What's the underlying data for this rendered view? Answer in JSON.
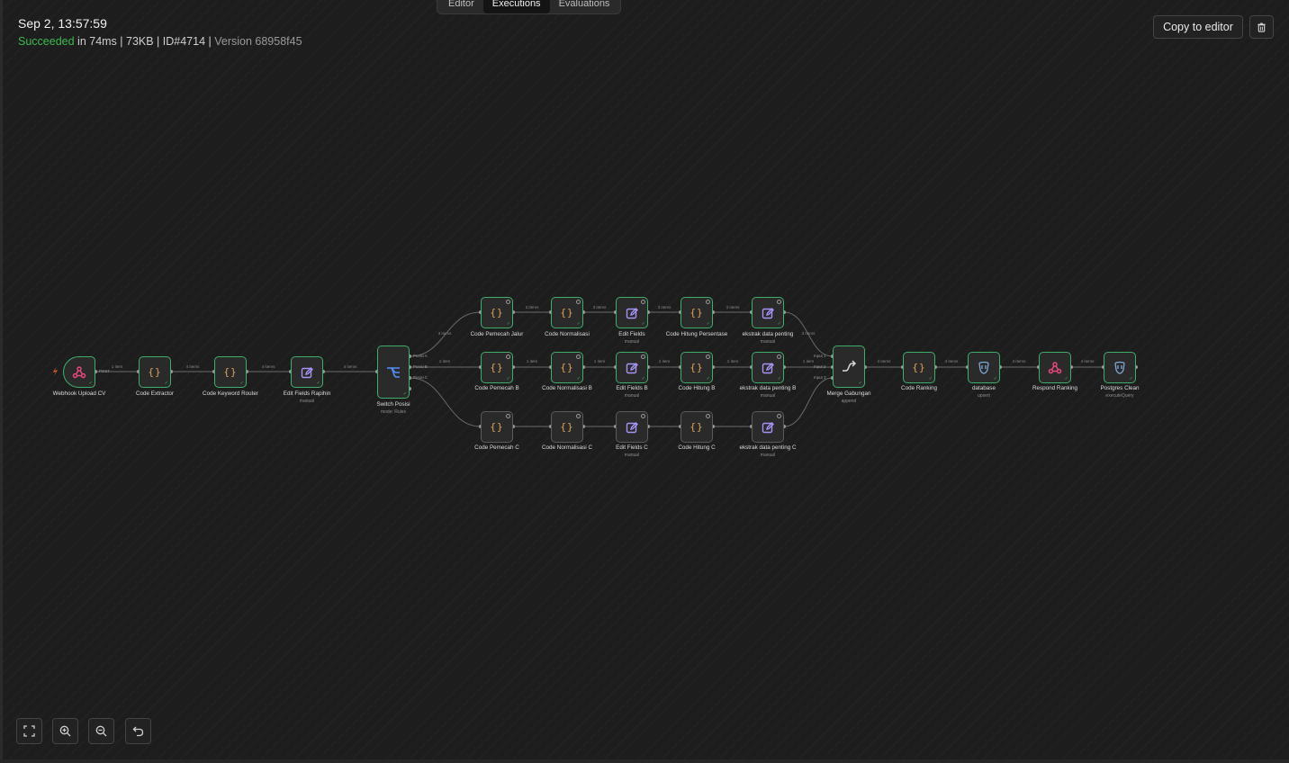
{
  "tabs": [
    {
      "label": "Editor",
      "active": false
    },
    {
      "label": "Executions",
      "active": true
    },
    {
      "label": "Evaluations",
      "active": false
    }
  ],
  "header": {
    "date": "Sep 2, 13:57:59",
    "status": "Succeeded",
    "details": " in 74ms | 73KB | ID#4714 | ",
    "version": "Version 68958f45"
  },
  "actions": {
    "copy_label": "Copy to editor",
    "delete_icon": "trash-icon"
  },
  "colors": {
    "success": "#3fb950",
    "node_border": "#3fae6a",
    "code_icon": "#e2a35a",
    "edit_icon": "#a892f6",
    "switch_icon": "#4f8ff7",
    "merge_icon": "#d9d9d9",
    "webhook_icon": "#e5487a",
    "postgres_icon": "#7fa7d9"
  },
  "nodes": [
    {
      "id": "webhook",
      "label": "Webhook Upload CV",
      "sub": "",
      "icon": "webhook-icon"
    },
    {
      "id": "code_extractor",
      "label": "Code Extractor",
      "sub": "",
      "icon": "code-icon"
    },
    {
      "id": "code_keyword",
      "label": "Code Keyword Router",
      "sub": "",
      "icon": "code-icon"
    },
    {
      "id": "edit_rapihin",
      "label": "Edit Fields Rapihin",
      "sub": "manual",
      "icon": "edit-icon"
    },
    {
      "id": "switch",
      "label": "Switch Posisi",
      "sub": "mode: Rules",
      "icon": "switch-icon"
    },
    {
      "id": "pemecah_jalur",
      "label": "Code Pemecah Jalur",
      "sub": "",
      "icon": "code-icon"
    },
    {
      "id": "normalisasi",
      "label": "Code Normalisasi",
      "sub": "",
      "icon": "code-icon"
    },
    {
      "id": "edit_fields",
      "label": "Edit Fields",
      "sub": "manual",
      "icon": "edit-icon"
    },
    {
      "id": "hitung_persentase",
      "label": "Code Hitung Persentase",
      "sub": "",
      "icon": "code-icon"
    },
    {
      "id": "ekstrak",
      "label": "ekstrak data penting",
      "sub": "manual",
      "icon": "edit-icon"
    },
    {
      "id": "pemecah_b",
      "label": "Code Pemecah B",
      "sub": "",
      "icon": "code-icon"
    },
    {
      "id": "normalisasi_b",
      "label": "Code Normalisasi B",
      "sub": "",
      "icon": "code-icon"
    },
    {
      "id": "edit_b",
      "label": "Edit Fields B",
      "sub": "manual",
      "icon": "edit-icon"
    },
    {
      "id": "hitung_b",
      "label": "Code Hitung B",
      "sub": "",
      "icon": "code-icon"
    },
    {
      "id": "ekstrak_b",
      "label": "ekstrak data penting B",
      "sub": "manual",
      "icon": "edit-icon"
    },
    {
      "id": "pemecah_c",
      "label": "Code Pemecah C",
      "sub": "",
      "icon": "code-icon"
    },
    {
      "id": "normalisasi_c",
      "label": "Code Normalisasi C",
      "sub": "",
      "icon": "code-icon"
    },
    {
      "id": "edit_c",
      "label": "Edit Fields C",
      "sub": "manual",
      "icon": "edit-icon"
    },
    {
      "id": "hitung_c",
      "label": "Code Hitung C",
      "sub": "",
      "icon": "code-icon"
    },
    {
      "id": "ekstrak_c",
      "label": "ekstrak data penting C",
      "sub": "manual",
      "icon": "edit-icon"
    },
    {
      "id": "merge",
      "label": "Merge Gabungan",
      "sub": "append",
      "icon": "merge-icon"
    },
    {
      "id": "ranking",
      "label": "Code Ranking",
      "sub": "",
      "icon": "code-icon"
    },
    {
      "id": "database",
      "label": "database",
      "sub": "upsert",
      "icon": "postgres-icon"
    },
    {
      "id": "respond",
      "label": "Respond Ranking",
      "sub": "",
      "icon": "webhook-icon"
    },
    {
      "id": "pg_clean",
      "label": "Postgres Clean",
      "sub": "executeQuery",
      "icon": "postgres-icon"
    }
  ],
  "edge_labels": {
    "e1": "1 item",
    "e2": "4 items",
    "e3": "4 items",
    "e4": "4 items",
    "sa": "3 items",
    "sb": "1 item",
    "a1": "3 items",
    "a2": "3 items",
    "a3": "3 items",
    "a4": "3 items",
    "b1": "1 item",
    "b2": "1 item",
    "b3": "1 item",
    "b4": "1 item",
    "ma": "3 items",
    "mb": "1 item",
    "m1": "4 items",
    "m2": "4 items",
    "m3": "4 items",
    "m4": "4 items"
  },
  "ports": {
    "switch_a": "Posisi A",
    "switch_b": "Posisi B",
    "switch_c": "Posisi C",
    "merge_1": "Input 1",
    "merge_2": "Input 2",
    "merge_3": "Input 3",
    "webhook_out": "POST"
  },
  "controls": [
    {
      "name": "fit-view-button",
      "icon": "fit-view-icon"
    },
    {
      "name": "zoom-in-button",
      "icon": "zoom-in-icon"
    },
    {
      "name": "zoom-out-button",
      "icon": "zoom-out-icon"
    },
    {
      "name": "reset-zoom-button",
      "icon": "undo-icon"
    }
  ]
}
